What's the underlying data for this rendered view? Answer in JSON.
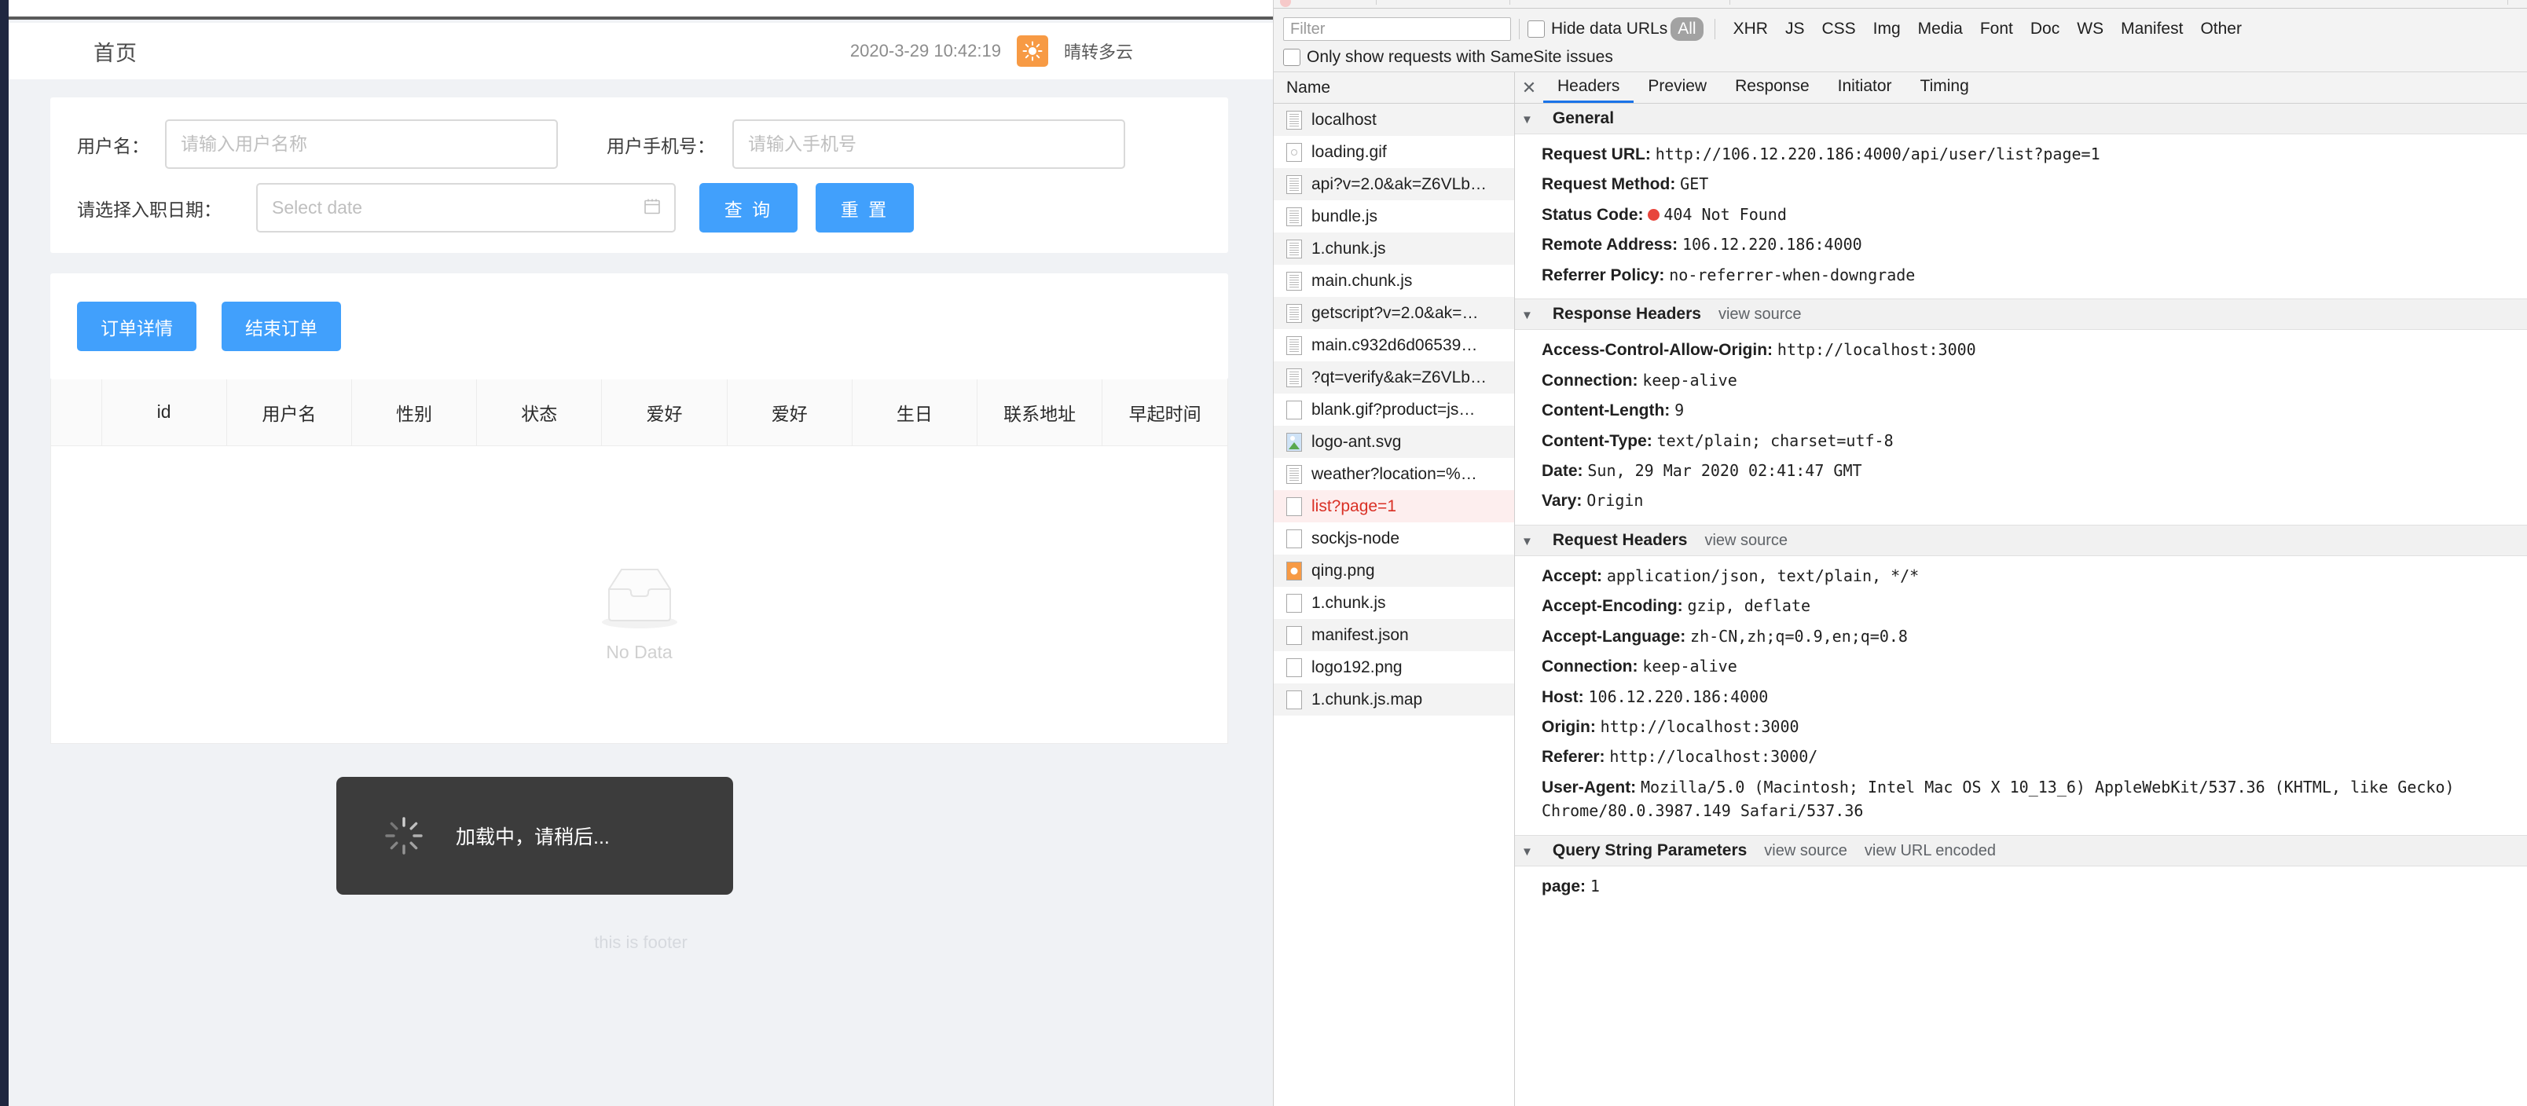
{
  "app": {
    "page_title": "首页",
    "datetime": "2020-3-29 10:42:19",
    "weather_icon": "sun-icon",
    "weather_text": "晴转多云",
    "search_form": {
      "username_label": "用户名：",
      "username_value": "",
      "username_placeholder": "请输入用户名称",
      "phone_label": "用户手机号：",
      "phone_value": "",
      "phone_placeholder": "请输入手机号",
      "date_label": "请选择入职日期：",
      "date_value": "",
      "date_placeholder": "Select date",
      "calendar_icon": "calendar-icon",
      "search_button": "查 询",
      "reset_button": "重 置"
    },
    "actions": {
      "order_detail_button": "订单详情",
      "end_order_button": "结束订单"
    },
    "table": {
      "columns": [
        "",
        "id",
        "用户名",
        "性别",
        "状态",
        "爱好",
        "爱好",
        "生日",
        "联系地址",
        "早起时间"
      ],
      "rows": [],
      "empty_text": "No Data",
      "empty_icon": "empty-inbox-icon"
    },
    "toast": {
      "spinner_icon": "loading-spinner-icon",
      "text": "加载中，请稍后..."
    },
    "footer_text": "this is footer",
    "accent_color": "#41a0fc",
    "weather_badge_color": "#f79a44"
  },
  "devtools": {
    "filter": {
      "placeholder": "Filter",
      "value": "",
      "hide_data_urls_label": "Hide data URLs",
      "hide_data_urls_checked": false,
      "types": [
        "All",
        "XHR",
        "JS",
        "CSS",
        "Img",
        "Media",
        "Font",
        "Doc",
        "WS",
        "Manifest",
        "Other"
      ],
      "active_type": "All",
      "samesite_label": "Only show requests with SameSite issues",
      "samesite_checked": false
    },
    "requests": {
      "column_header": "Name",
      "items": [
        {
          "name": "localhost",
          "icon": "document-icon",
          "error": false
        },
        {
          "name": "loading.gif",
          "icon": "gif-icon",
          "error": false
        },
        {
          "name": "api?v=2.0&ak=Z6VLb…",
          "icon": "document-icon",
          "error": false
        },
        {
          "name": "bundle.js",
          "icon": "document-icon",
          "error": false
        },
        {
          "name": "1.chunk.js",
          "icon": "document-icon",
          "error": false
        },
        {
          "name": "main.chunk.js",
          "icon": "document-icon",
          "error": false
        },
        {
          "name": "getscript?v=2.0&ak=…",
          "icon": "document-icon",
          "error": false
        },
        {
          "name": "main.c932d6d06539…",
          "icon": "document-icon",
          "error": false
        },
        {
          "name": "?qt=verify&ak=Z6VLb…",
          "icon": "document-icon",
          "error": false
        },
        {
          "name": "blank.gif?product=js…",
          "icon": "blank-icon",
          "error": false
        },
        {
          "name": "logo-ant.svg",
          "icon": "image-icon",
          "error": false
        },
        {
          "name": "weather?location=%…",
          "icon": "document-icon",
          "error": false
        },
        {
          "name": "list?page=1",
          "icon": "blank-icon",
          "error": true
        },
        {
          "name": "sockjs-node",
          "icon": "blank-icon",
          "error": false
        },
        {
          "name": "qing.png",
          "icon": "png-image-icon",
          "error": false
        },
        {
          "name": "1.chunk.js",
          "icon": "blank-icon",
          "error": false
        },
        {
          "name": "manifest.json",
          "icon": "blank-icon",
          "error": false
        },
        {
          "name": "logo192.png",
          "icon": "blank-icon",
          "error": false
        },
        {
          "name": "1.chunk.js.map",
          "icon": "blank-icon",
          "error": false
        }
      ]
    },
    "detail": {
      "close_icon": "close-icon",
      "tabs": [
        "Headers",
        "Preview",
        "Response",
        "Initiator",
        "Timing"
      ],
      "active_tab": "Headers",
      "sections": [
        {
          "title": "General",
          "links": [],
          "rows": [
            {
              "key": "Request URL:",
              "value": "http://106.12.220.186:4000/api/user/list?page=1"
            },
            {
              "key": "Request Method:",
              "value": "GET"
            },
            {
              "key": "Status Code:",
              "value": "404 Not Found",
              "status_dot": true
            },
            {
              "key": "Remote Address:",
              "value": "106.12.220.186:4000"
            },
            {
              "key": "Referrer Policy:",
              "value": "no-referrer-when-downgrade"
            }
          ]
        },
        {
          "title": "Response Headers",
          "links": [
            "view source"
          ],
          "rows": [
            {
              "key": "Access-Control-Allow-Origin:",
              "value": "http://localhost:3000"
            },
            {
              "key": "Connection:",
              "value": "keep-alive"
            },
            {
              "key": "Content-Length:",
              "value": "9"
            },
            {
              "key": "Content-Type:",
              "value": "text/plain; charset=utf-8"
            },
            {
              "key": "Date:",
              "value": "Sun, 29 Mar 2020 02:41:47 GMT"
            },
            {
              "key": "Vary:",
              "value": "Origin"
            }
          ]
        },
        {
          "title": "Request Headers",
          "links": [
            "view source"
          ],
          "rows": [
            {
              "key": "Accept:",
              "value": "application/json, text/plain, */*"
            },
            {
              "key": "Accept-Encoding:",
              "value": "gzip, deflate"
            },
            {
              "key": "Accept-Language:",
              "value": "zh-CN,zh;q=0.9,en;q=0.8"
            },
            {
              "key": "Connection:",
              "value": "keep-alive"
            },
            {
              "key": "Host:",
              "value": "106.12.220.186:4000"
            },
            {
              "key": "Origin:",
              "value": "http://localhost:3000"
            },
            {
              "key": "Referer:",
              "value": "http://localhost:3000/"
            },
            {
              "key": "User-Agent:",
              "value": "Mozilla/5.0 (Macintosh; Intel Mac OS X 10_13_6) AppleWebKit/537.36 (KHTML, like Gecko) Chrome/80.0.3987.149 Safari/537.36"
            }
          ]
        },
        {
          "title": "Query String Parameters",
          "links": [
            "view source",
            "view URL encoded"
          ],
          "rows": [
            {
              "key": "page:",
              "value": "1"
            }
          ]
        }
      ]
    }
  }
}
